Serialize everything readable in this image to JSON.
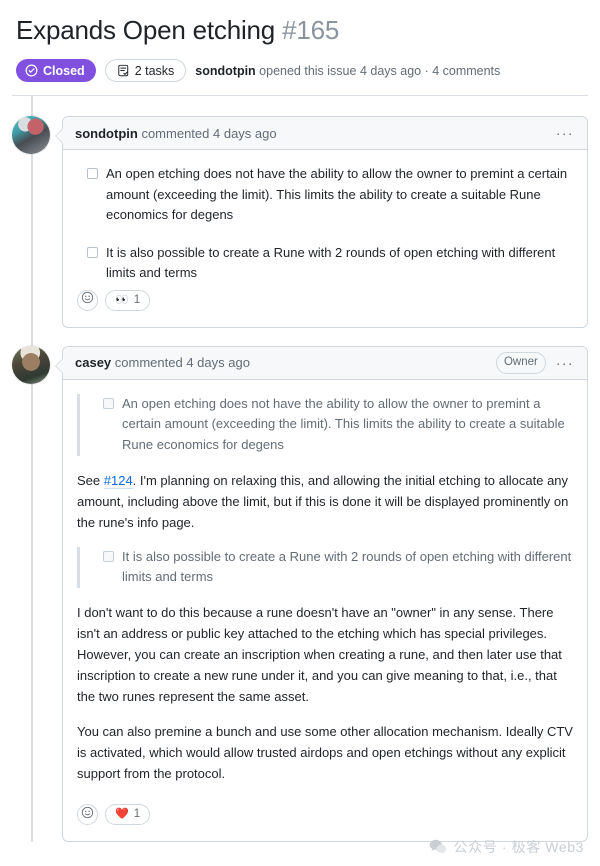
{
  "issue": {
    "title": "Expands Open etching",
    "number": "#165",
    "state_label": "Closed",
    "state_color": "#8250df",
    "tasks_label": "2 tasks",
    "meta_author": "sondotpin",
    "meta_text": " opened this issue 4 days ago · 4 comments"
  },
  "comments": [
    {
      "author": "sondotpin",
      "action": "commented",
      "time": "4 days ago",
      "badge": null,
      "kebab": "···",
      "tasks": [
        "An open etching does not have the ability to allow the owner to premint a certain amount (exceeding the limit). This limits the ability to create a suitable Rune economics for degens",
        "It is also possible to create a Rune with 2 rounds of open etching with different limits and terms"
      ],
      "reactions": [
        {
          "emoji": "👀",
          "name": "eyes-reaction",
          "count": "1"
        }
      ]
    },
    {
      "author": "casey",
      "action": "commented",
      "time": "4 days ago",
      "badge": "Owner",
      "kebab": "···",
      "quote_one": "An open etching does not have the ability to allow the owner to premint a certain amount (exceeding the limit). This limits the ability to create a suitable Rune economics for degens",
      "reply_one_pre": "See ",
      "reply_one_link": "#124",
      "reply_one_post": ". I'm planning on relaxing this, and allowing the initial etching to allocate any amount, including above the limit, but if this is done it will be displayed prominently on the rune's info page.",
      "quote_two": "It is also possible to create a Rune with 2 rounds of open etching with different limits and terms",
      "reply_two": "I don't want to do this because a rune doesn't have an \"owner\" in any sense. There isn't an address or public key attached to the etching which has special privileges. However, you can create an inscription when creating a rune, and then later use that inscription to create a new rune under it, and you can give meaning to that, i.e., that the two runes represent the same asset.",
      "reply_three": "You can also premine a bunch and use some other allocation mechanism. Ideally CTV is activated, which would allow trusted airdops and open etchings without any explicit support from the protocol.",
      "reactions": [
        {
          "emoji": "❤️",
          "name": "heart-reaction",
          "count": "1"
        }
      ]
    }
  ],
  "watermark": {
    "text": "公众号 · 极客 Web3"
  }
}
